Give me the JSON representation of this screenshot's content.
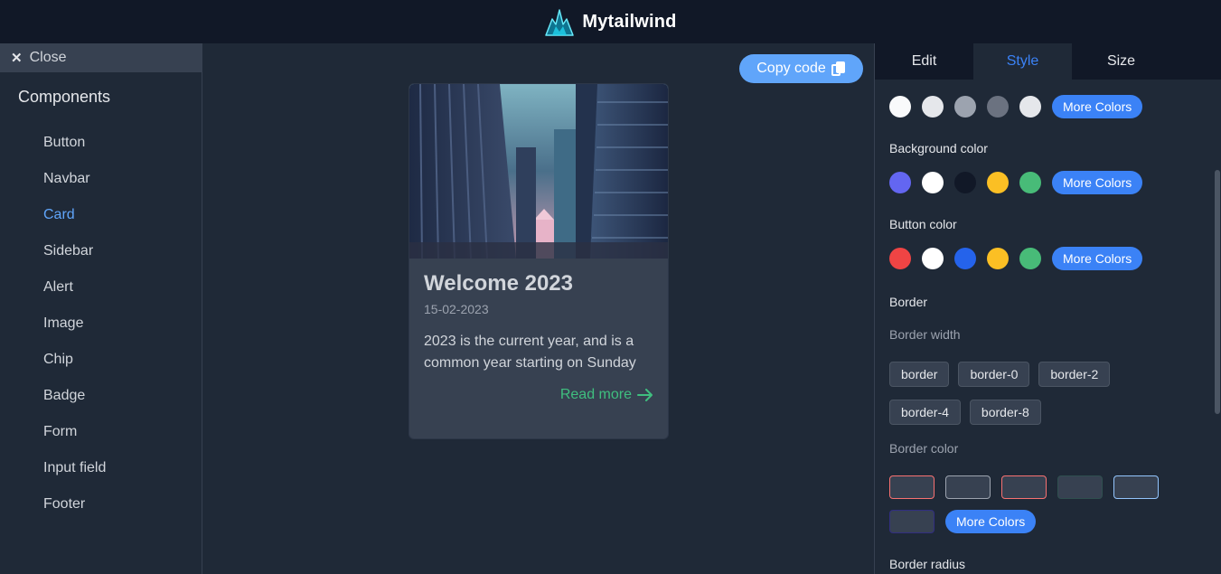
{
  "brand": {
    "name": "Mytailwind",
    "logo_icon": "mountain-logo-icon"
  },
  "sidebar": {
    "close_label": "Close",
    "heading": "Components",
    "items": [
      {
        "label": "Button",
        "active": false
      },
      {
        "label": "Navbar",
        "active": false
      },
      {
        "label": "Card",
        "active": true
      },
      {
        "label": "Sidebar",
        "active": false
      },
      {
        "label": "Alert",
        "active": false
      },
      {
        "label": "Image",
        "active": false
      },
      {
        "label": "Chip",
        "active": false
      },
      {
        "label": "Badge",
        "active": false
      },
      {
        "label": "Form",
        "active": false
      },
      {
        "label": "Input field",
        "active": false
      },
      {
        "label": "Footer",
        "active": false
      }
    ]
  },
  "center": {
    "copy_label": "Copy code",
    "copy_icon": "copy-icon",
    "card": {
      "image_alt": "city-buildings-photo",
      "title": "Welcome 2023",
      "date": "15-02-2023",
      "text": "2023 is the current year, and is a common year starting on Sunday",
      "link": "Read more",
      "link_icon": "arrow-right-icon"
    }
  },
  "panel": {
    "tabs": [
      "Edit",
      "Style",
      "Size"
    ],
    "active_tab": "Style",
    "text_colors": [
      "#f9fafb",
      "#e5e7eb",
      "#9ca3af",
      "#6b7280",
      "#e5e7eb"
    ],
    "more_colors": "More Colors",
    "background_label": "Background color",
    "background_colors": [
      "#6366f1",
      "#ffffff",
      "#111827",
      "#fbbf24",
      "#48bb78"
    ],
    "button_label": "Button color",
    "button_colors": [
      "#ef4444",
      "#ffffff",
      "#2563eb",
      "#fbbf24",
      "#48bb78"
    ],
    "border_label": "Border",
    "border_width_label": "Border width",
    "border_widths": [
      "border",
      "border-0",
      "border-2",
      "border-4",
      "border-8"
    ],
    "border_color_label": "Border color",
    "border_colors": [
      "#f87171",
      "#9ca3af",
      "#f87171",
      "#2f4f4f",
      "#93c5fd",
      "#312e81"
    ],
    "border_radius_label": "Border radius"
  }
}
